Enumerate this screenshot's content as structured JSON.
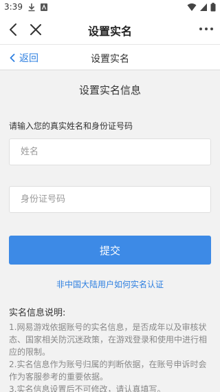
{
  "status_bar": {
    "time": "3:39"
  },
  "app_header": {
    "title": "设置实名"
  },
  "page_header": {
    "back_label": "返回",
    "title": "设置实名"
  },
  "form": {
    "section_title": "设置实名信息",
    "instruction": "请输入您的真实姓名和身份证号码",
    "name_placeholder": "姓名",
    "name_value": "",
    "id_placeholder": "身份证号码",
    "id_value": "",
    "submit_label": "提交",
    "help_link": "非中国大陆用户如何实名认证"
  },
  "notes": {
    "title": "实名信息说明:",
    "lines": [
      "1.网易游戏依据账号的实名信息，是否成年以及审核状态、国家相关防沉迷政策，在游戏登录和使用中进行相应的限制。",
      "2.实名信息作为账号归属的判断依据，在账号申诉时会作为客服参考的重要依据。",
      "3.实名信息设置后不可修改，请认真填写。"
    ]
  },
  "colors": {
    "accent": "#3d8ae6",
    "link": "#2d7fe0",
    "background": "#f2f2f2"
  }
}
